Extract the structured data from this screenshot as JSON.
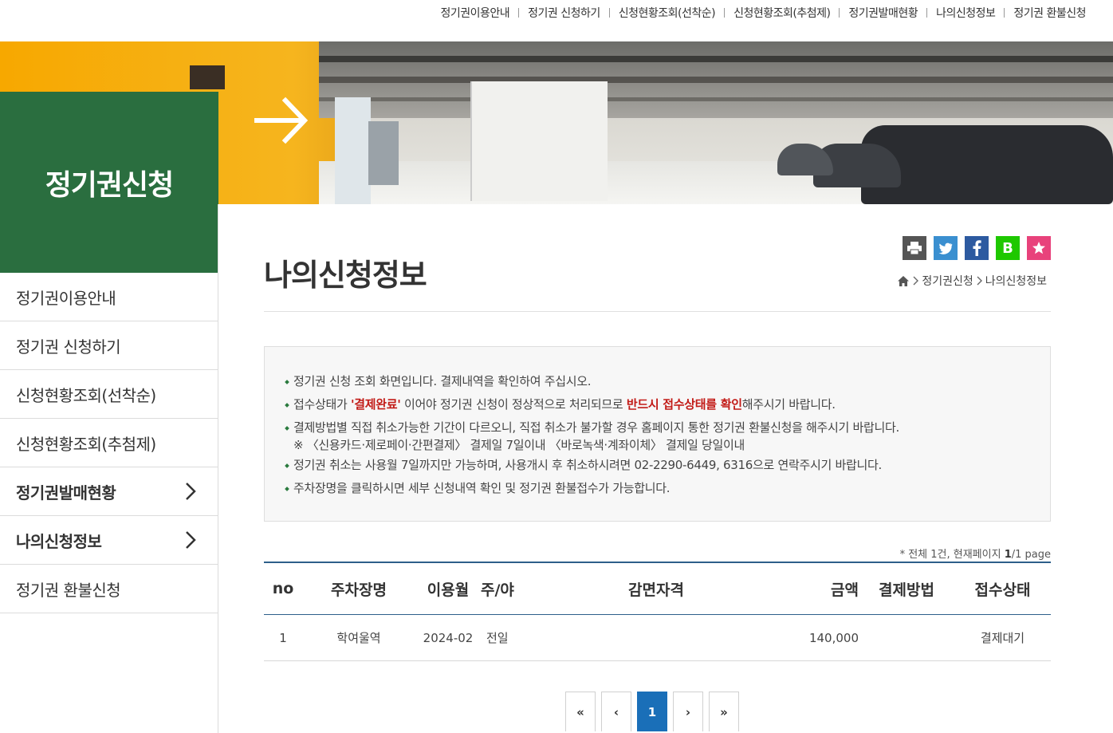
{
  "topnav": [
    "정기권이용안내",
    "정기권 신청하기",
    "신청현황조회(선착순)",
    "신청현황조회(추첨제)",
    "정기권발매현황",
    "나의신청정보",
    "정기권 환불신청"
  ],
  "section_title": "정기권신청",
  "sidemenu": [
    {
      "label": "정기권이용안내"
    },
    {
      "label": "정기권 신청하기"
    },
    {
      "label": "신청현황조회(선착순)"
    },
    {
      "label": "신청현황조회(추첨제)"
    },
    {
      "label": "정기권발매현황"
    },
    {
      "label": "나의신청정보"
    },
    {
      "label": "정기권 환불신청"
    }
  ],
  "page_title": "나의신청정보",
  "share": {
    "colors": {
      "print": "#555555",
      "twitter": "#3a8fd0",
      "facebook": "#2d5aa0",
      "blog": "#1ec800",
      "bookmark": "#e8427b"
    },
    "blog_letter": "B"
  },
  "breadcrumb": [
    "정기권신청",
    "나의신청정보"
  ],
  "notice": {
    "line1": "정기권 신청 조회 화면입니다. 결제내역을 확인하여 주십시오.",
    "line2_a": "접수상태가 ",
    "line2_b": "'결제완료'",
    "line2_c": " 이어야 정기권 신청이 정상적으로 처리되므로 ",
    "line2_d": "반드시 접수상태를 확인",
    "line2_e": "해주시기 바랍니다.",
    "line3": "결제방법별 직접 취소가능한 기간이 다르오니, 직접 취소가 불가할 경우 홈페이지 통한 정기권 환불신청을 해주시기 바랍니다.",
    "line3_sub": "※ 〈신용카드·제로페이·간편결제〉 결제일 7일이내 〈바로녹색·계좌이체〉 결제일 당일이내",
    "line4": "정기권 취소는 사용월 7일까지만 가능하며, 사용개시 후 취소하시려면 02-2290-6449, 6316으로 연락주시기 바랍니다.",
    "line5": "주차장명을 클릭하시면 세부 신청내역 확인 및 정기권 환불접수가 가능합니다."
  },
  "summary": {
    "prefix": "* 전체 1건, 현재페이지 ",
    "current": "1",
    "suffix": "/1 page"
  },
  "table": {
    "headers": [
      "no",
      "주차장명",
      "이용월",
      "주/야",
      "감면자격",
      "금액",
      "결제방법",
      "접수상태"
    ],
    "rows": [
      {
        "no": "1",
        "lot": "학여울역",
        "month": "2024-02",
        "daynight": "전일",
        "reduction": "",
        "amount": "140,000",
        "payment": "",
        "status": "결제대기"
      }
    ]
  },
  "paging": {
    "first": "«",
    "prev": "‹",
    "current": "1",
    "next": "›",
    "last": "»"
  }
}
